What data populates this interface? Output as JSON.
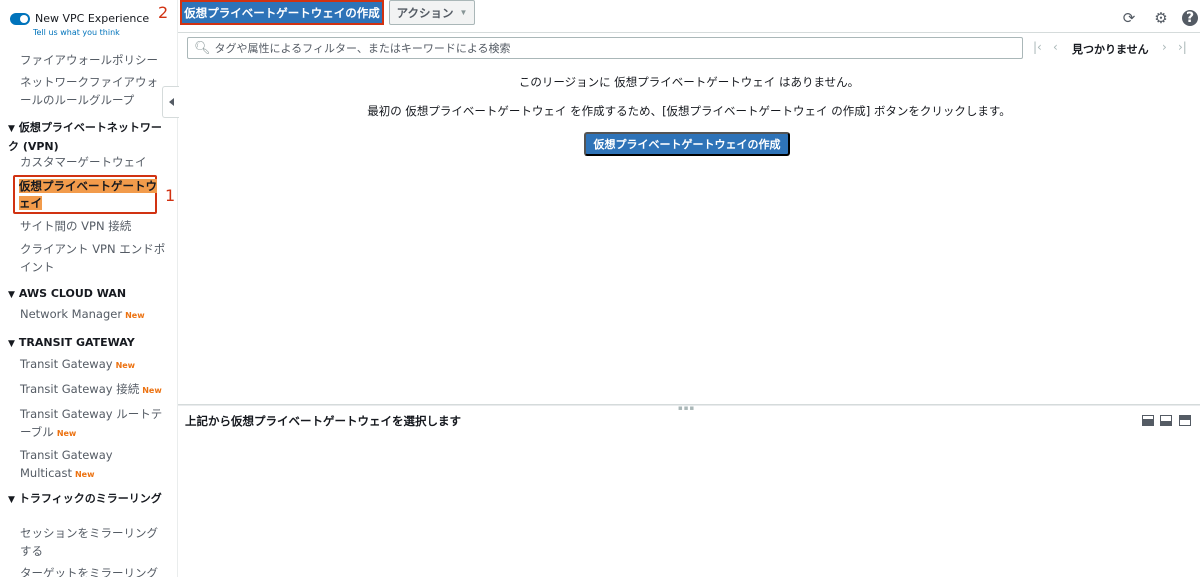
{
  "sidebar": {
    "vpc_toggle_label": "New VPC Experience",
    "vpc_toggle_sub": "Tell us what you think",
    "items": {
      "firewall_policy": "ファイアウォールポリシー",
      "firewall_rule_groups": "ネットワークファイアウォールのルールグループ",
      "vpn_section": "仮想プライベートネットワーク (VPN)",
      "customer_gateway": "カスタマーゲートウェイ",
      "virtual_private_gateway": "仮想プライベートゲートウェイ",
      "site_to_site_vpn": "サイト間の VPN 接続",
      "client_vpn_endpoint": "クライアント VPN エンドポイント",
      "cloud_wan_section": "AWS CLOUD WAN",
      "network_manager": "Network Manager",
      "transit_section": "TRANSIT GATEWAY",
      "transit_gateway": "Transit Gateway",
      "transit_gateway_attachments": "Transit Gateway 接続",
      "transit_gateway_route_table": "Transit Gateway ルートテーブル",
      "transit_gateway_multicast": "Transit Gateway Multicast",
      "traffic_mirroring_section": "トラフィックのミラーリング",
      "mirror_sessions": "セッションをミラーリングする",
      "mirror_targets": "ターゲットをミラーリング"
    },
    "new_badge": "New",
    "annotation_1": "1"
  },
  "toolbar": {
    "annotation_2": "2",
    "create_label": "仮想プライベートゲートウェイの作成",
    "actions_label": "アクション"
  },
  "search": {
    "placeholder": "タグや属性によるフィルター、またはキーワードによる検索"
  },
  "pager": {
    "status": "見つかりません"
  },
  "empty_state": {
    "line1": "このリージョンに 仮想プライベートゲートウェイ はありません。",
    "line2": "最初の 仮想プライベートゲートウェイ を作成するため、[仮想プライベートゲートウェイ の作成] ボタンをクリックします。",
    "button_label": "仮想プライベートゲートウェイの作成"
  },
  "detail": {
    "title": "上記から仮想プライベートゲートウェイを選択します"
  },
  "icons": [
    "refresh-icon",
    "settings-icon",
    "help-icon",
    "search-icon"
  ],
  "colors": {
    "primary_button": "#2e73b8",
    "annotation_red": "#d13212",
    "active_highlight": "#f29b4b",
    "new_badge": "#ec7211",
    "link_blue": "#0073bb"
  }
}
